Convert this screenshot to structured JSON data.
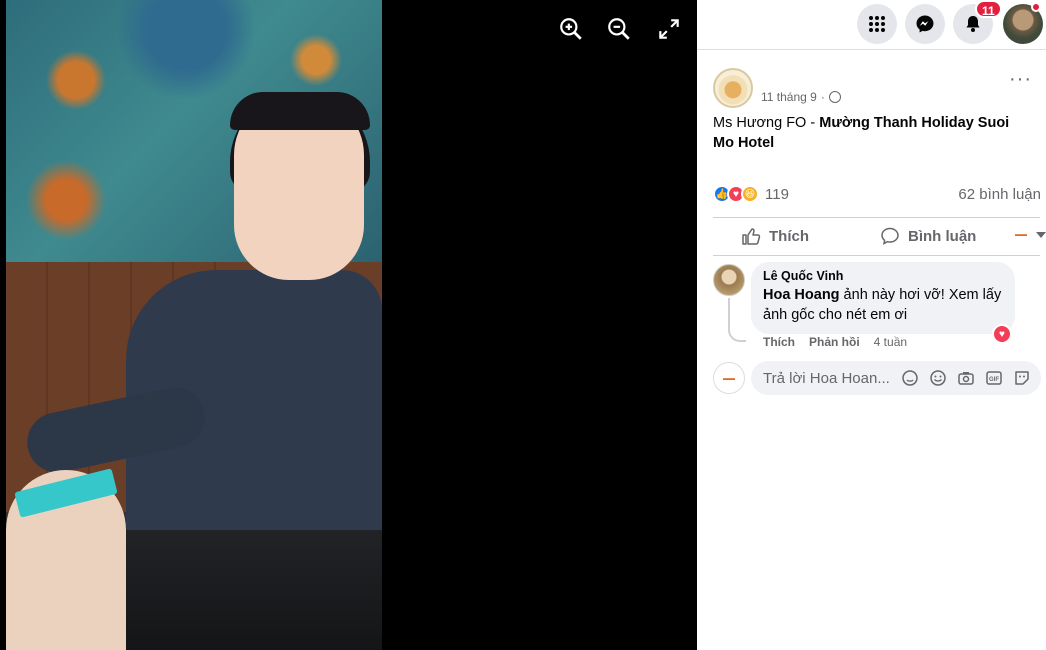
{
  "viewer": {
    "zoom_in": "zoom-in",
    "zoom_out": "zoom-out",
    "fullscreen": "fullscreen"
  },
  "topbar": {
    "menu_icon": "grid-menu-icon",
    "messenger_icon": "messenger-icon",
    "notifications_icon": "bell-icon",
    "notifications_count": "11"
  },
  "post": {
    "author": "",
    "time": "11 tháng 9",
    "privacy_icon": "globe-icon",
    "text_prefix": "Ms Hương FO - ",
    "text_bold": "Mường Thanh Holiday Suoi Mo Hotel",
    "reaction_count": "119",
    "comment_count": "62 bình luận",
    "actions": {
      "like": "Thích",
      "comment": "Bình luận"
    }
  },
  "comment": {
    "author": "Lê Quốc Vinh",
    "mention": "Hoa Hoang",
    "text": " ảnh này hơi vỡ! Xem lấy ảnh gốc cho nét em ơi",
    "like": "Thích",
    "reply": "Phản hồi",
    "age": "4 tuần"
  },
  "reply_box": {
    "placeholder": "Trả lời Hoa Hoan..."
  },
  "colors": {
    "accent": "#1877f2",
    "love": "#f33e58",
    "badge": "#e41e3f",
    "secondary_text": "#65676b"
  }
}
